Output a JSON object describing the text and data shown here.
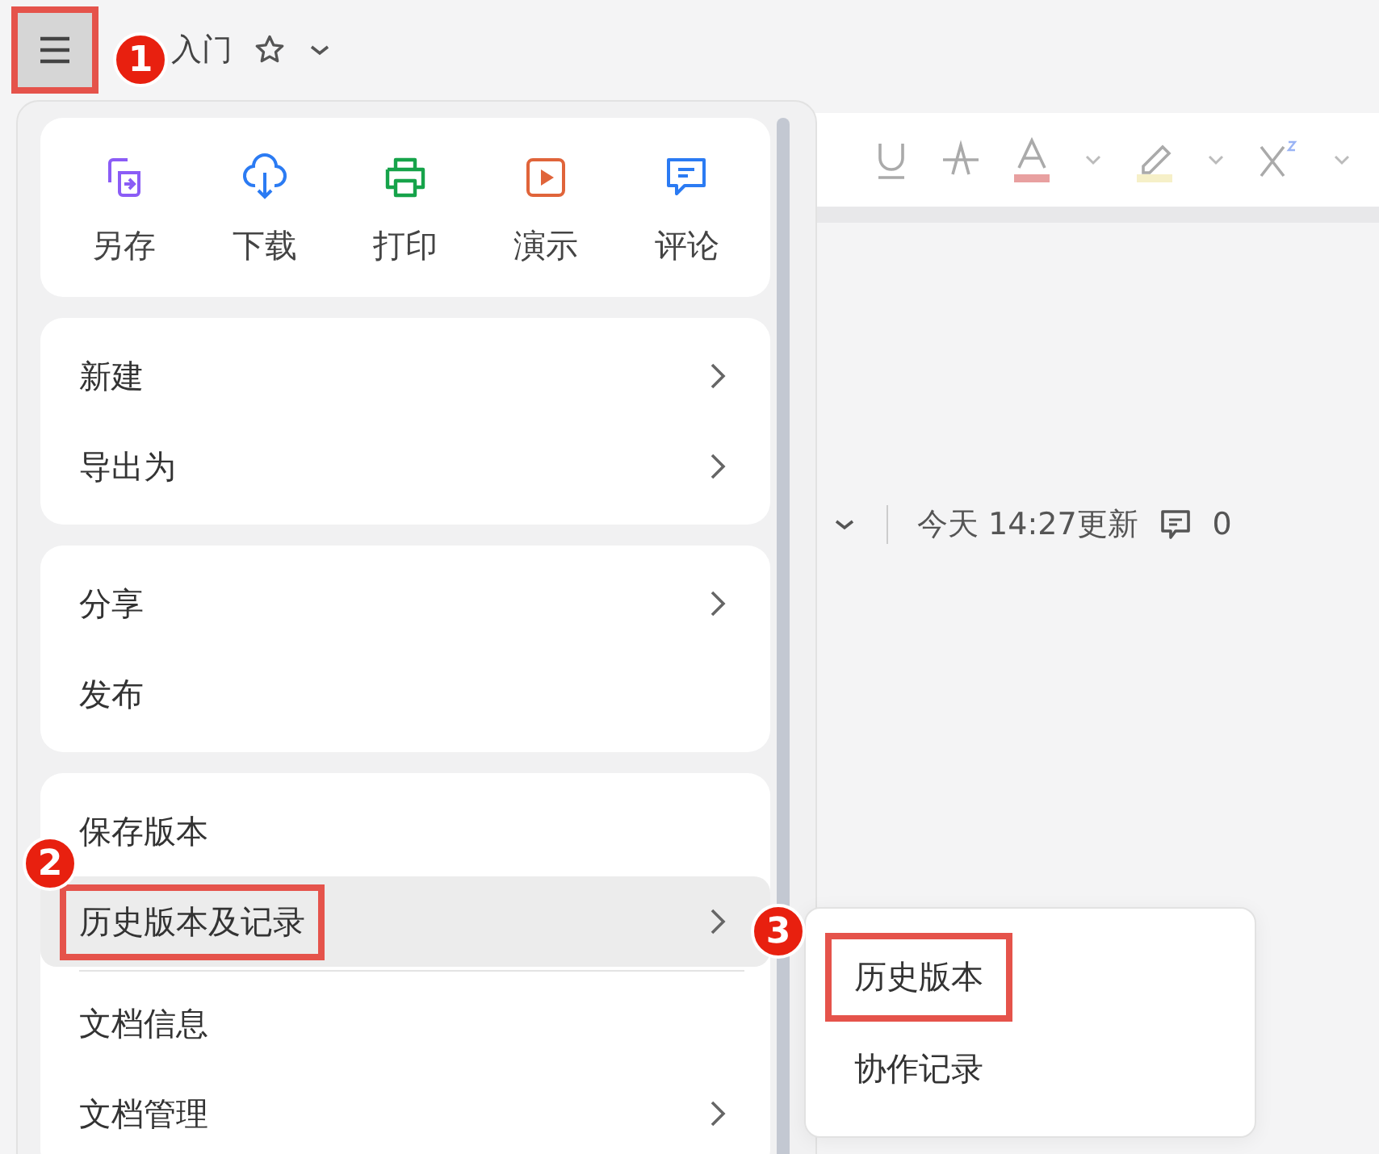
{
  "topbar": {
    "title": "入门",
    "annotated": true
  },
  "badges": [
    "1",
    "2",
    "3"
  ],
  "quick_actions": [
    {
      "label": "另存",
      "kind": "save-as"
    },
    {
      "label": "下载",
      "kind": "download"
    },
    {
      "label": "打印",
      "kind": "print"
    },
    {
      "label": "演示",
      "kind": "present"
    },
    {
      "label": "评论",
      "kind": "comment"
    }
  ],
  "menu_groups": [
    [
      {
        "label": "新建",
        "has_submenu": true,
        "selected": false,
        "annotated": false
      },
      {
        "label": "导出为",
        "has_submenu": true,
        "selected": false,
        "annotated": false
      }
    ],
    [
      {
        "label": "分享",
        "has_submenu": true,
        "selected": false,
        "annotated": false
      },
      {
        "label": "发布",
        "has_submenu": false,
        "selected": false,
        "annotated": false
      }
    ],
    [
      {
        "label": "保存版本",
        "has_submenu": false,
        "selected": false,
        "annotated": false
      },
      {
        "label": "历史版本及记录",
        "has_submenu": true,
        "selected": true,
        "annotated": true,
        "divider_after": true
      },
      {
        "label": "文档信息",
        "has_submenu": false,
        "selected": false,
        "annotated": false
      },
      {
        "label": "文档管理",
        "has_submenu": true,
        "selected": false,
        "annotated": false
      }
    ]
  ],
  "submenu": [
    {
      "label": "历史版本",
      "annotated": true
    },
    {
      "label": "协作记录",
      "annotated": false
    }
  ],
  "document": {
    "updated": "今天 14:27更新",
    "comment_count": "0"
  }
}
